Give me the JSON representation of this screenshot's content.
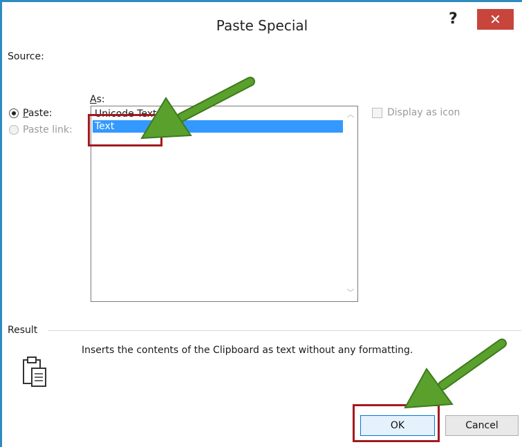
{
  "dialog": {
    "title": "Paste Special",
    "help_label": "?",
    "close_label": "✕"
  },
  "source": {
    "label": "Source:"
  },
  "as": {
    "label_underlined": "A",
    "label_rest": "s:"
  },
  "radio_options": [
    {
      "label_underlined": "P",
      "label_rest": "aste:",
      "checked": true,
      "disabled": false
    },
    {
      "label_underlined": "",
      "label_rest": "Paste link:",
      "checked": false,
      "disabled": true
    }
  ],
  "as_list": {
    "items": [
      {
        "label": "Unicode Text",
        "selected": false
      },
      {
        "label": "Text",
        "selected": true
      }
    ]
  },
  "display_as_icon": {
    "label": "Display as icon",
    "checked": false,
    "disabled": true
  },
  "result": {
    "label": "Result",
    "text": "Inserts the contents of the Clipboard as text without any formatting.",
    "icon": "clipboard-paste-icon"
  },
  "buttons": {
    "ok_label": "OK",
    "cancel_label": "Cancel"
  },
  "annotations": {
    "highlight_color": "#a11a1f",
    "arrow_color": "#5aa02c"
  }
}
